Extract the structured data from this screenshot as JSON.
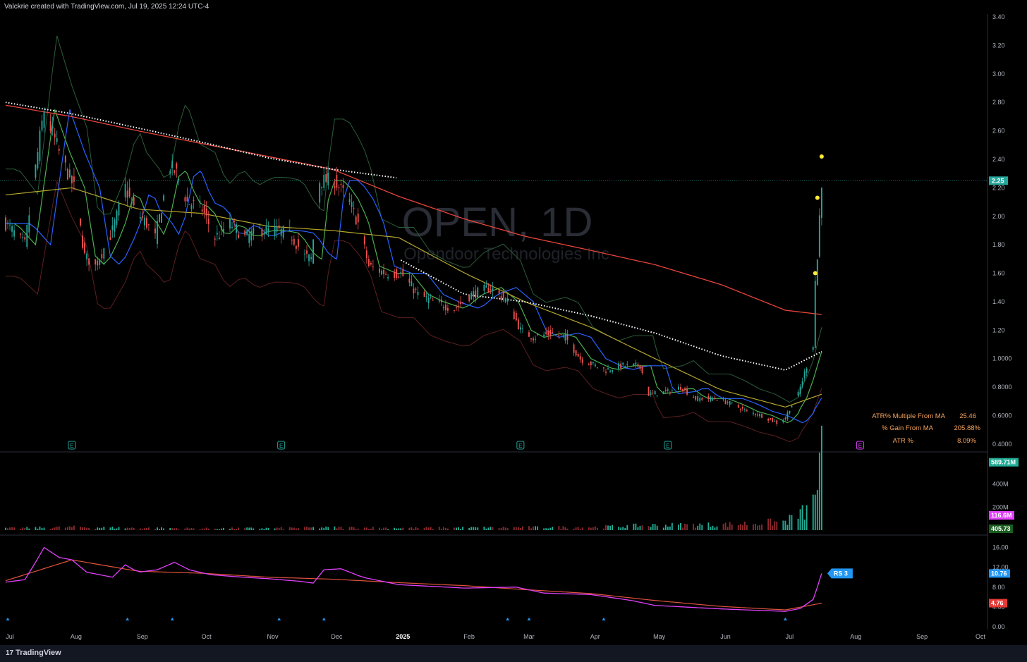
{
  "header": {
    "caption": "Valckrie created with TradingView.com, Jul 19, 2025 12:24 UTC-4"
  },
  "footer": {
    "logo_text": "TradingView",
    "logo_mark": "17"
  },
  "watermark": {
    "symbol": "OPEN, 1D",
    "company": "Opendoor Technologies Inc"
  },
  "colors": {
    "bg": "#000000",
    "up": "#26a69a",
    "down": "#ef5350",
    "up_vol": "#22ab94",
    "ma_red": "#e8453c",
    "ma_white": "#ffffff",
    "ma_yellow": "#b5a72c",
    "ema_green": "#4caf50",
    "ema_blue": "#2962ff",
    "bb": "#2b5d3a",
    "rs_line": "#e040fb",
    "rs_blue": "#2196f3",
    "rs_ma": "#e0533d",
    "stat_text": "#f7a35c",
    "earnings": "#26a69a"
  },
  "stats": [
    {
      "label": "ATR% Multiple From MA",
      "value": "25.46"
    },
    {
      "label": "% Gain From MA",
      "value": "205.88%"
    },
    {
      "label": "ATR %",
      "value": "8.09%"
    }
  ],
  "chart_data": [
    {
      "type": "candlestick",
      "title": "OPEN, 1D",
      "subtitle": "Opendoor Technologies Inc",
      "price_axis_ticks": [
        "3.40",
        "3.20",
        "3.00",
        "2.80",
        "2.60",
        "2.40",
        "2.20",
        "2.00",
        "1.80",
        "1.60",
        "1.40",
        "1.20",
        "1.0000",
        "0.8000",
        "0.6000",
        "0.4000"
      ],
      "last_price_label": "2.25",
      "last_price": 2.25,
      "x_axis_labels": [
        "Jul",
        "Aug",
        "Sep",
        "Oct",
        "Nov",
        "Dec",
        "2025",
        "Feb",
        "Mar",
        "Apr",
        "May",
        "Jun",
        "Jul",
        "Aug",
        "Sep",
        "Oct"
      ],
      "ylim": [
        0.35,
        3.42
      ],
      "x_range": [
        "2024-07-01",
        "2025-10-01"
      ],
      "close_anchors": [
        [
          "2024-07-01",
          1.95
        ],
        [
          "2024-07-10",
          1.8
        ],
        [
          "2024-07-17",
          2.55
        ],
        [
          "2024-07-19",
          2.75
        ],
        [
          "2024-07-26",
          2.45
        ],
        [
          "2024-08-02",
          2.2
        ],
        [
          "2024-08-07",
          1.72
        ],
        [
          "2024-08-12",
          1.65
        ],
        [
          "2024-08-20",
          1.9
        ],
        [
          "2024-08-26",
          2.2
        ],
        [
          "2024-08-30",
          2.05
        ],
        [
          "2024-09-05",
          1.95
        ],
        [
          "2024-09-09",
          1.85
        ],
        [
          "2024-09-16",
          2.35
        ],
        [
          "2024-09-19",
          2.3
        ],
        [
          "2024-09-24",
          2.1
        ],
        [
          "2024-10-01",
          2.05
        ],
        [
          "2024-10-07",
          1.85
        ],
        [
          "2024-10-14",
          1.95
        ],
        [
          "2024-10-21",
          1.85
        ],
        [
          "2024-10-28",
          1.9
        ],
        [
          "2024-11-04",
          1.9
        ],
        [
          "2024-11-11",
          1.88
        ],
        [
          "2024-11-18",
          1.72
        ],
        [
          "2024-11-21",
          1.7
        ],
        [
          "2024-11-25",
          2.25
        ],
        [
          "2024-12-02",
          2.25
        ],
        [
          "2024-12-09",
          2.1
        ],
        [
          "2024-12-13",
          1.95
        ],
        [
          "2024-12-18",
          1.65
        ],
        [
          "2024-12-26",
          1.6
        ],
        [
          "2025-01-02",
          1.6
        ],
        [
          "2025-01-10",
          1.45
        ],
        [
          "2025-01-17",
          1.4
        ],
        [
          "2025-01-27",
          1.35
        ],
        [
          "2025-02-04",
          1.45
        ],
        [
          "2025-02-13",
          1.5
        ],
        [
          "2025-02-21",
          1.4
        ],
        [
          "2025-02-27",
          1.2
        ],
        [
          "2025-03-05",
          1.15
        ],
        [
          "2025-03-14",
          1.18
        ],
        [
          "2025-03-20",
          1.15
        ],
        [
          "2025-03-27",
          1.0
        ],
        [
          "2025-04-03",
          0.95
        ],
        [
          "2025-04-08",
          0.92
        ],
        [
          "2025-04-15",
          0.95
        ],
        [
          "2025-04-24",
          0.95
        ],
        [
          "2025-04-28",
          0.75
        ],
        [
          "2025-05-08",
          0.77
        ],
        [
          "2025-05-13",
          0.8
        ],
        [
          "2025-05-20",
          0.72
        ],
        [
          "2025-05-30",
          0.72
        ],
        [
          "2025-06-06",
          0.68
        ],
        [
          "2025-06-13",
          0.63
        ],
        [
          "2025-06-20",
          0.6
        ],
        [
          "2025-06-27",
          0.55
        ],
        [
          "2025-07-01",
          0.58
        ],
        [
          "2025-07-03",
          0.65
        ],
        [
          "2025-07-07",
          0.75
        ],
        [
          "2025-07-09",
          0.85
        ],
        [
          "2025-07-11",
          0.95
        ],
        [
          "2025-07-14",
          1.1
        ],
        [
          "2025-07-15",
          1.55
        ],
        [
          "2025-07-16",
          1.7
        ],
        [
          "2025-07-17",
          2.0
        ],
        [
          "2025-07-18",
          2.25
        ]
      ],
      "ma_red_anchors": [
        [
          "2024-07-01",
          2.78
        ],
        [
          "2024-08-01",
          2.7
        ],
        [
          "2024-09-01",
          2.6
        ],
        [
          "2024-10-01",
          2.51
        ],
        [
          "2024-11-01",
          2.42
        ],
        [
          "2024-12-01",
          2.33
        ],
        [
          "2025-01-01",
          2.14
        ],
        [
          "2025-02-01",
          1.98
        ],
        [
          "2025-03-01",
          1.86
        ],
        [
          "2025-04-01",
          1.76
        ],
        [
          "2025-05-01",
          1.66
        ],
        [
          "2025-06-01",
          1.52
        ],
        [
          "2025-07-01",
          1.34
        ],
        [
          "2025-07-18",
          1.31
        ]
      ],
      "ma_white_anchors": [
        [
          "2024-07-01",
          2.8
        ],
        [
          "2024-08-01",
          2.72
        ],
        [
          "2024-09-01",
          2.62
        ],
        [
          "2024-10-01",
          2.52
        ],
        [
          "2024-11-01",
          2.41
        ],
        [
          "2024-12-01",
          2.33
        ],
        [
          "2024-12-31",
          2.27
        ]
      ],
      "ma_white_anchors_2": [
        [
          "2025-01-01",
          1.7
        ],
        [
          "2025-02-01",
          1.45
        ],
        [
          "2025-03-01",
          1.4
        ],
        [
          "2025-04-01",
          1.3
        ],
        [
          "2025-05-01",
          1.18
        ],
        [
          "2025-06-01",
          1.02
        ],
        [
          "2025-07-01",
          0.92
        ],
        [
          "2025-07-18",
          1.05
        ]
      ],
      "ma_yellow_anchors": [
        [
          "2024-07-01",
          2.15
        ],
        [
          "2024-08-01",
          2.2
        ],
        [
          "2024-09-01",
          2.05
        ],
        [
          "2024-10-01",
          2.02
        ],
        [
          "2024-11-01",
          1.93
        ],
        [
          "2024-12-01",
          1.9
        ],
        [
          "2025-01-01",
          1.85
        ],
        [
          "2025-02-01",
          1.6
        ],
        [
          "2025-03-01",
          1.4
        ],
        [
          "2025-04-01",
          1.22
        ],
        [
          "2025-05-01",
          1.0
        ],
        [
          "2025-06-01",
          0.78
        ],
        [
          "2025-07-01",
          0.66
        ],
        [
          "2025-07-18",
          0.75
        ]
      ],
      "markers_yellow": [
        [
          "2025-07-15",
          1.6
        ],
        [
          "2025-07-16",
          2.13
        ],
        [
          "2025-07-18",
          2.42
        ]
      ],
      "earnings_markers": [
        "2024-08-01",
        "2024-11-07",
        "2025-02-27",
        "2025-05-07"
      ],
      "next_earnings_marker": "2025-08-05"
    },
    {
      "type": "bar",
      "title": "Volume",
      "ticks": [
        "400M",
        "200M"
      ],
      "last_value_label": "589.71M",
      "last_value": 589.71,
      "vol_ma_label": "116.6M",
      "extra_label": "405.73",
      "ylim": [
        0,
        600
      ],
      "volume_anchors_millions": [
        [
          "2024-07-01",
          15
        ],
        [
          "2024-08-01",
          25
        ],
        [
          "2024-09-01",
          18
        ],
        [
          "2024-10-01",
          14
        ],
        [
          "2024-11-01",
          16
        ],
        [
          "2024-12-01",
          22
        ],
        [
          "2025-01-01",
          18
        ],
        [
          "2025-02-01",
          20
        ],
        [
          "2025-03-01",
          22
        ],
        [
          "2025-04-01",
          25
        ],
        [
          "2025-05-01",
          40
        ],
        [
          "2025-06-01",
          45
        ],
        [
          "2025-07-01",
          70
        ],
        [
          "2025-07-10",
          150
        ],
        [
          "2025-07-14",
          220
        ],
        [
          "2025-07-15",
          320
        ],
        [
          "2025-07-16",
          405
        ],
        [
          "2025-07-17",
          500
        ],
        [
          "2025-07-18",
          589
        ]
      ]
    },
    {
      "type": "line",
      "title": "RS",
      "ticks": [
        "16.00",
        "12.00",
        "8.00",
        "4.00",
        "0.00"
      ],
      "ylim": [
        0,
        17.5
      ],
      "rs_label": "RS 3",
      "rs_value_label": "10.76",
      "rs_value": 10.76,
      "rs_ma_label": "4.76",
      "rs_ma_value": 4.76,
      "rs_anchors": [
        [
          "2024-07-01",
          9.0
        ],
        [
          "2024-07-10",
          9.5
        ],
        [
          "2024-07-15",
          13.0
        ],
        [
          "2024-07-19",
          16.0
        ],
        [
          "2024-07-26",
          14.0
        ],
        [
          "2024-08-01",
          13.5
        ],
        [
          "2024-08-08",
          11.0
        ],
        [
          "2024-08-20",
          10.0
        ],
        [
          "2024-08-26",
          12.5
        ],
        [
          "2024-09-01",
          11.0
        ],
        [
          "2024-09-10",
          11.5
        ],
        [
          "2024-09-18",
          13.0
        ],
        [
          "2024-09-25",
          11.5
        ],
        [
          "2024-10-05",
          10.5
        ],
        [
          "2024-10-20",
          10.0
        ],
        [
          "2024-11-01",
          9.7
        ],
        [
          "2024-11-15",
          9.2
        ],
        [
          "2024-11-22",
          8.8
        ],
        [
          "2024-11-27",
          11.5
        ],
        [
          "2024-12-05",
          11.7
        ],
        [
          "2024-12-15",
          10.0
        ],
        [
          "2025-01-01",
          8.5
        ],
        [
          "2025-02-01",
          7.8
        ],
        [
          "2025-02-25",
          8.0
        ],
        [
          "2025-03-10",
          6.8
        ],
        [
          "2025-04-01",
          6.5
        ],
        [
          "2025-04-20",
          5.3
        ],
        [
          "2025-05-01",
          4.3
        ],
        [
          "2025-06-01",
          3.6
        ],
        [
          "2025-07-01",
          3.1
        ],
        [
          "2025-07-08",
          3.7
        ],
        [
          "2025-07-14",
          5.5
        ],
        [
          "2025-07-16",
          8.0
        ],
        [
          "2025-07-18",
          10.76
        ]
      ],
      "rs_ma_anchors": [
        [
          "2024-07-01",
          9.3
        ],
        [
          "2024-08-01",
          13.5
        ],
        [
          "2024-09-01",
          11.2
        ],
        [
          "2024-10-01",
          10.8
        ],
        [
          "2024-11-01",
          10.0
        ],
        [
          "2024-12-01",
          9.6
        ],
        [
          "2025-01-01",
          8.9
        ],
        [
          "2025-02-01",
          8.3
        ],
        [
          "2025-03-01",
          7.5
        ],
        [
          "2025-04-01",
          6.7
        ],
        [
          "2025-05-01",
          5.3
        ],
        [
          "2025-06-01",
          4.1
        ],
        [
          "2025-07-01",
          3.4
        ],
        [
          "2025-07-18",
          4.76
        ]
      ],
      "triangle_markers": [
        "2024-07-02",
        "2024-08-27",
        "2024-09-17",
        "2024-11-06",
        "2024-11-27",
        "2025-02-21",
        "2025-03-03",
        "2025-04-07",
        "2025-07-01"
      ]
    }
  ]
}
